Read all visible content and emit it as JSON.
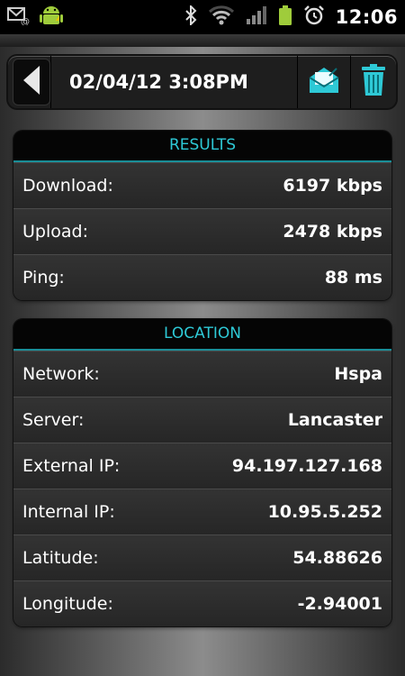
{
  "status_bar": {
    "time": "12:06",
    "icons": [
      "email-notification-icon",
      "android-icon",
      "bluetooth-icon",
      "wifi-icon",
      "signal-icon",
      "battery-icon",
      "alarm-icon"
    ]
  },
  "header": {
    "datetime": "02/04/12 3:08PM",
    "back_icon": "back-arrow-icon",
    "email_icon": "email-icon",
    "trash_icon": "trash-icon"
  },
  "results": {
    "title": "RESULTS",
    "rows": [
      {
        "label": "Download:",
        "value": "6197 kbps"
      },
      {
        "label": "Upload:",
        "value": "2478 kbps"
      },
      {
        "label": "Ping:",
        "value": "88 ms"
      }
    ]
  },
  "location": {
    "title": "LOCATION",
    "rows": [
      {
        "label": "Network:",
        "value": "Hspa"
      },
      {
        "label": "Server:",
        "value": "Lancaster"
      },
      {
        "label": "External IP:",
        "value": "94.197.127.168"
      },
      {
        "label": "Internal IP:",
        "value": "10.95.5.252"
      },
      {
        "label": "Latitude:",
        "value": "54.88626"
      },
      {
        "label": "Longitude:",
        "value": "-2.94001"
      }
    ]
  },
  "colors": {
    "accent": "#2ec9d6",
    "statusbar": "#000000"
  }
}
